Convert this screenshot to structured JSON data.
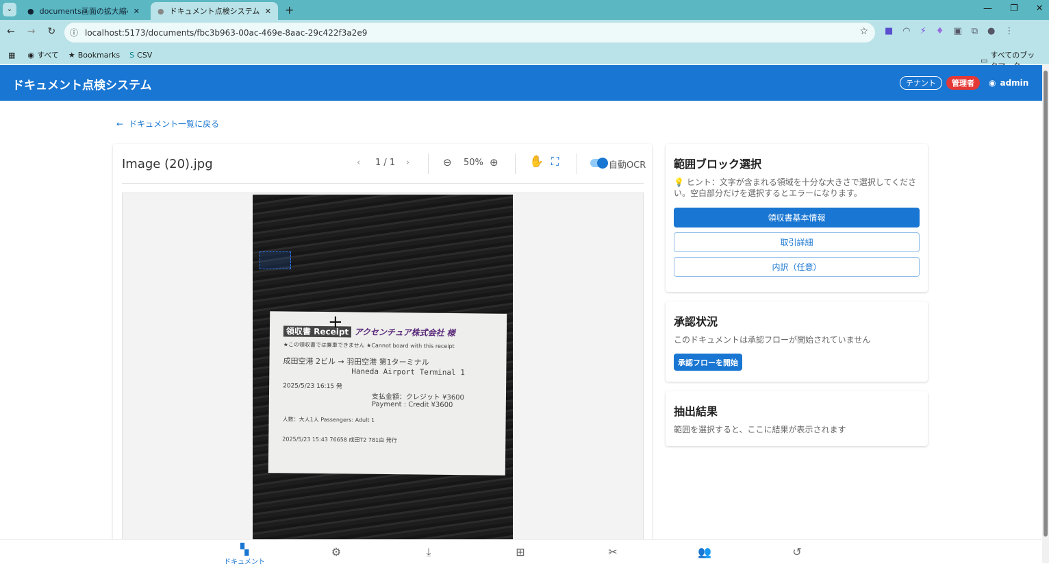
{
  "browser": {
    "tabs": [
      {
        "title": "documents画面の拡大縮小 - Issu"
      },
      {
        "title": "ドキュメント点検システム"
      }
    ],
    "url": "localhost:5173/documents/fbc3b963-00ac-469e-8aac-29c422f3a2e9",
    "bookmarks": [
      "すべて",
      "Bookmarks",
      "CSV"
    ],
    "all_bookmarks": "すべてのブックマーク"
  },
  "app": {
    "title": "ドキュメント点検システム",
    "tenant": "テナント",
    "role": "管理者",
    "user": "admin",
    "accent": "#1976d2"
  },
  "back_link": "ドキュメント一覧に戻る",
  "viewer": {
    "filename": "Image (20).jpg",
    "page": "1 / 1",
    "zoom": "50%",
    "auto_ocr_label": "自動OCR",
    "auto_ocr": true,
    "receipt_lines": [
      "領収書 Receipt",
      "アクセンチュア株式会社 様",
      "★この領収書では乗車できません ★Cannot board with this receipt",
      "成田空港 2ビル → 羽田空港 第1ターミナル",
      "Haneda Airport Terminal 1",
      "2025/5/23 16:15 発",
      "支払金額：クレジット ¥3600",
      "Payment : Credit ¥3600",
      "人数：大人1人 Passengers: Adult 1",
      "2025/5/23 15:43 76658 成田T2 781白 発行"
    ]
  },
  "block_select": {
    "title": "範囲ブロック選択",
    "hint": "ヒント：文字が含まれる領域を十分な大きさで選択してください。空白部分だけを選択するとエラーになります。",
    "buttons": [
      "領収書基本情報",
      "取引詳細",
      "内訳（任意）"
    ]
  },
  "approval": {
    "title": "承認状況",
    "status": "このドキュメントは承認フローが開始されていません",
    "start_button": "承認フローを開始"
  },
  "extract": {
    "title": "抽出結果",
    "message": "範囲を選択すると、ここに結果が表示されます"
  },
  "bottom_nav": {
    "items": [
      {
        "label": "ドキュメント",
        "icon": "dashboard-icon"
      },
      {
        "icon": "gear-icon"
      },
      {
        "icon": "download-icon"
      },
      {
        "icon": "flow-icon"
      },
      {
        "icon": "tools-icon"
      },
      {
        "icon": "people-icon"
      },
      {
        "icon": "history-icon"
      }
    ]
  }
}
